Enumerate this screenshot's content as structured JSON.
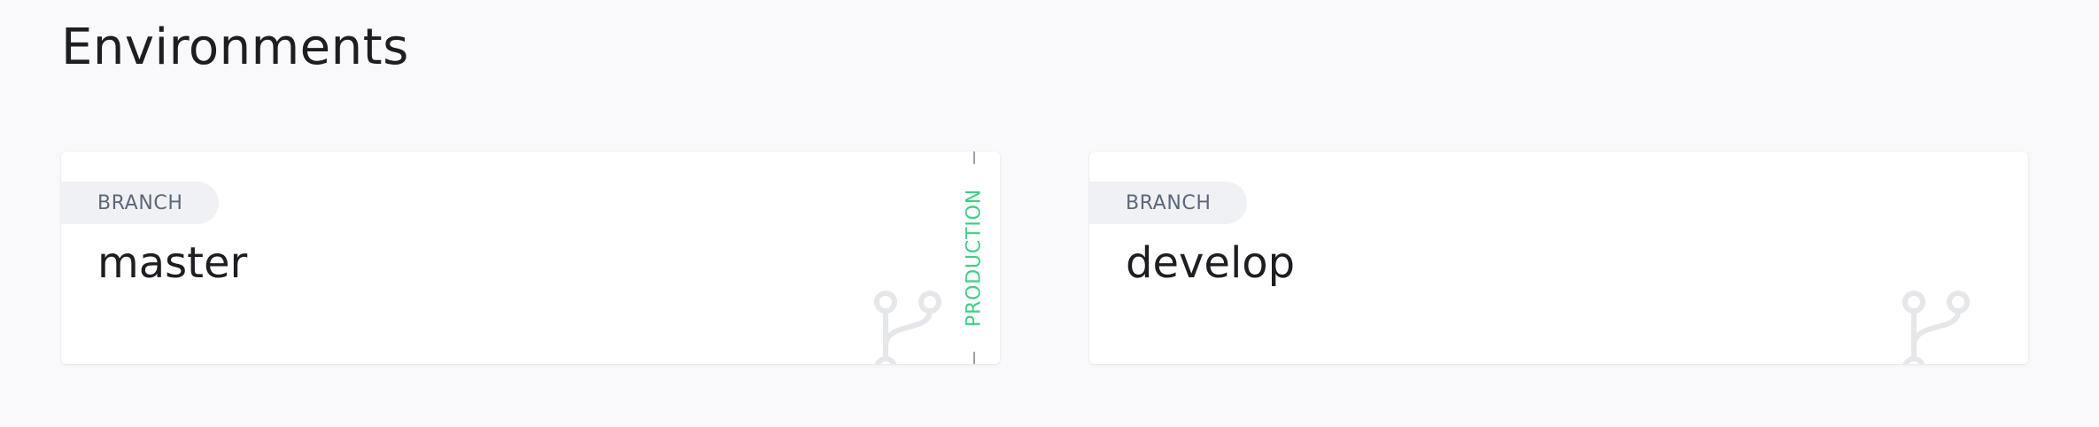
{
  "page": {
    "title": "Environments"
  },
  "environments": [
    {
      "type_label": "BRANCH",
      "name": "master",
      "tag": "PRODUCTION"
    },
    {
      "type_label": "BRANCH",
      "name": "develop"
    }
  ],
  "icons": {
    "branch": "git-branch-icon"
  },
  "colors": {
    "background": "#f9f9fb",
    "card": "#ffffff",
    "pill": "#f0f1f5",
    "pill_text": "#5d6778",
    "production": "#3ecf86",
    "icon": "#e6e7ea"
  }
}
